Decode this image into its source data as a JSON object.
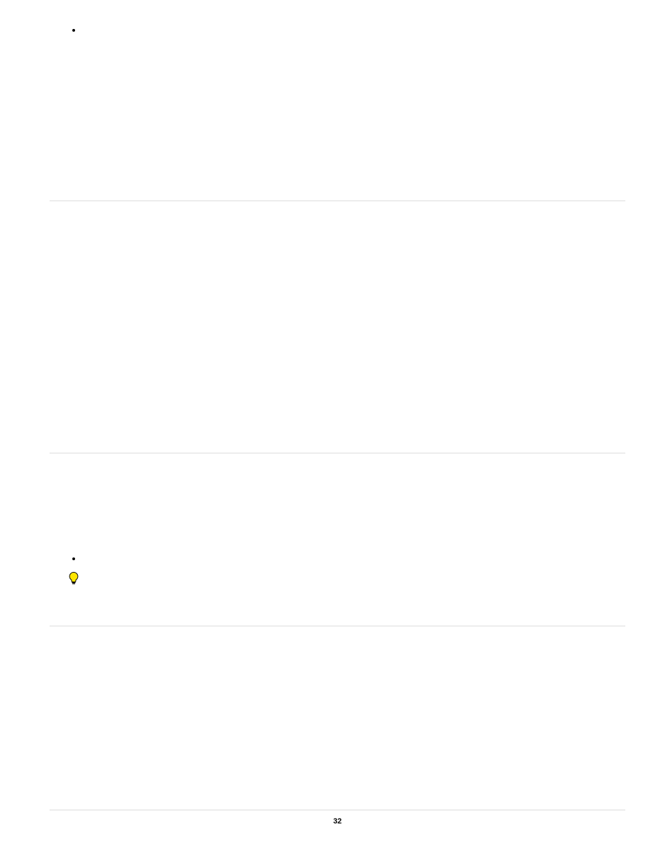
{
  "page_number": "32"
}
